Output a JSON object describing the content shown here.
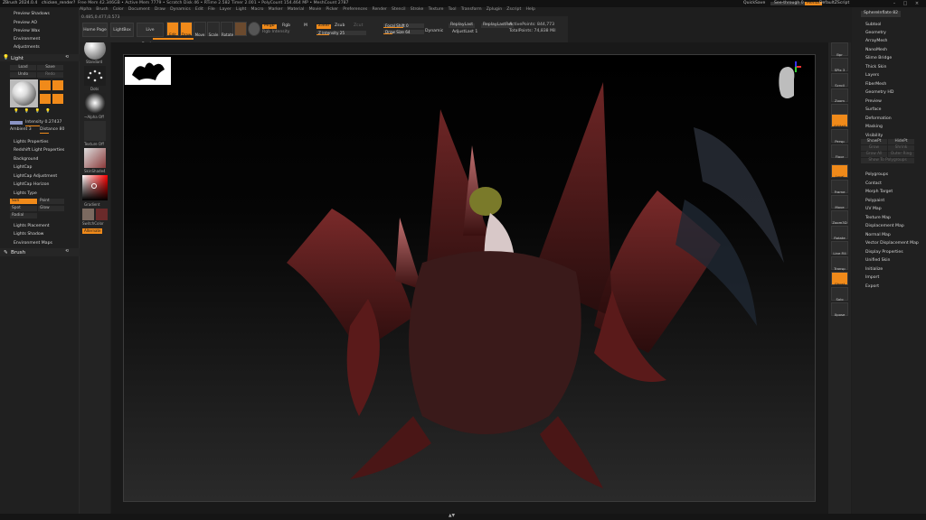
{
  "titlebar": {
    "app": "ZBrush 2024.0.4",
    "doc": "chicken_render?",
    "stats": "Free Mem 42.346GB • Active Mem 7779 • Scratch Disk 46 • RTime 2.582 Timer 2.001 • PolyCount 154.464 MP • MeshCount 2787",
    "quicksave": "QuickSave",
    "seethrough": "See-through 0",
    "menus_label": "Menus",
    "script": "DefaultZScript"
  },
  "menubar": [
    "Alpha",
    "Brush",
    "Color",
    "Document",
    "Draw",
    "Dynamics",
    "Edit",
    "File",
    "Layer",
    "Light",
    "Macro",
    "Marker",
    "Material",
    "Movie",
    "Picker",
    "Preferences",
    "Render",
    "Stencil",
    "Stroke",
    "Texture",
    "Tool",
    "Transform",
    "Zplugin",
    "Zscript",
    "Help"
  ],
  "coords": "0.485,0.477,0.573",
  "left": {
    "top_items": [
      "Preview Shadows",
      "Preview AO",
      "Preview Wax",
      "Environment",
      "Adjustments"
    ],
    "light_header": "Light",
    "load": "Load",
    "save": "Save",
    "undo": "Undo",
    "redo": "Redo",
    "intensity": "Intensity 0.27437",
    "ambient": "Ambient 3",
    "distance": "Distance 80",
    "items": [
      "Lights Properties",
      "Redshift Light Properties",
      "Background",
      "LightCap",
      "LightCap Adjustment",
      "LightCap Horizon"
    ],
    "lights_type": "Lights Type",
    "sun": "Sun",
    "point": "Point",
    "spot": "Spot",
    "glow": "Glow",
    "radial": "Radial",
    "items2": [
      "Lights Placement",
      "Lights Shadow",
      "Environment Maps"
    ],
    "brush_header": "Brush"
  },
  "tools": {
    "brush": "Standard",
    "stroke": "Dots",
    "alpha": "~Alpha Off",
    "texture": "Texture Off",
    "material": "SkinShade4",
    "gradient": "Gradient",
    "switch": "SwitchColor",
    "alternate": "Alternate"
  },
  "shelf": {
    "home": "Home Page",
    "lightbox": "LightBox",
    "boolean": "Live Boolean",
    "edit": "Edit",
    "draw": "Draw",
    "move": "Move",
    "scale": "Scale",
    "rotate": "Rotate",
    "mrgb": "Mrgb",
    "rgb": "Rgb",
    "m": "M",
    "zadd": "Zadd",
    "zsub": "Zsub",
    "zcut": "Zcut",
    "rgb_intensity": "Rgb Intensity",
    "z_intensity": "Z Intensity 25",
    "focal_shift": "Focal Shift 0",
    "draw_size": "Draw Size 64",
    "dynamic": "Dynamic",
    "replay_last": "ReplayLast",
    "replay_last_rel": "ReplayLastRel",
    "active_points": "ActivePoints: 844,773",
    "total_points": "TotalPoints: 74,838 Mil",
    "adjust_last": "AdjustLast 1"
  },
  "rightshelf": [
    "Bpr",
    "SPix 3",
    "Scroll",
    "Zoom",
    "Actual",
    "AAHalf",
    "Persp",
    "Floor",
    "Local",
    "Frame",
    "Move",
    "Zoom3D",
    "Rotate",
    "Line Fill PolyF",
    "Transp",
    "Ghost",
    "Solo",
    "Xpose"
  ],
  "right": {
    "top": "SphereInflate 82",
    "items": [
      "Subtool",
      "Geometry",
      "ArrayMesh",
      "NanoMesh",
      "Slime Bridge",
      "Thick Skin",
      "Layers",
      "FiberMesh",
      "Geometry HD",
      "Preview",
      "Surface",
      "Deformation",
      "Masking",
      "Visibility"
    ],
    "vis": [
      "ShowPt",
      "HidePt",
      "Grow",
      "Shrink",
      "Grow All",
      "Outer Ring",
      "Show To Polygroups"
    ],
    "items2": [
      "Polygroups",
      "Contact",
      "Morph Target",
      "Polypaint",
      "UV Map",
      "Texture Map",
      "Displacement Map",
      "Normal Map",
      "Vector Displacement Map",
      "Display Properties",
      "Unified Skin",
      "Initialize",
      "Import",
      "Export"
    ]
  },
  "colors": {
    "accent": "#f08a1a",
    "panel": "#202020",
    "viewport_top": "#000000",
    "viewport_bottom": "#2a2a2a"
  }
}
